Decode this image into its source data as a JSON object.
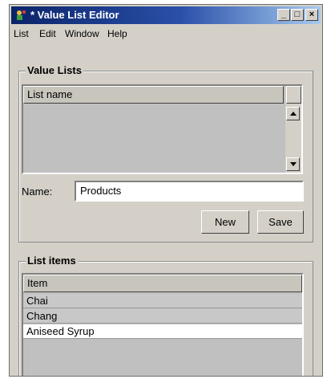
{
  "window": {
    "title": "* Value List Editor"
  },
  "menu": [
    "List",
    "Edit",
    "Window",
    "Help"
  ],
  "value_lists": {
    "group_title": "Value Lists",
    "column_header": "List name",
    "name_label": "Name:",
    "name_value": "Products",
    "new_label": "New",
    "save_label": "Save"
  },
  "list_items": {
    "group_title": "List items",
    "column_header": "Item",
    "rows": [
      "Chai",
      "Chang",
      "Aniseed Syrup"
    ],
    "selected_index": 2
  }
}
